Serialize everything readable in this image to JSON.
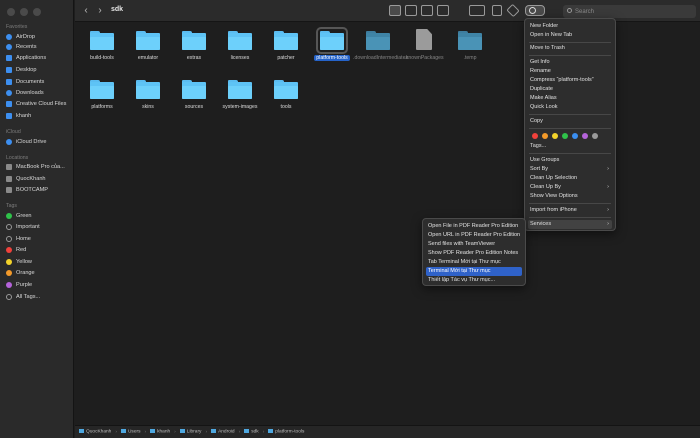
{
  "window": {
    "title": "sdk"
  },
  "search": {
    "placeholder": "Search"
  },
  "sidebar": {
    "favorites_header": "Favorites",
    "favorites": [
      "AirDrop",
      "Recents",
      "Applications",
      "Desktop",
      "Documents",
      "Downloads",
      "Creative Cloud Files",
      "khanh"
    ],
    "icloud_header": "iCloud",
    "icloud": [
      "iCloud Drive"
    ],
    "locations_header": "Locations",
    "locations": [
      "MacBook Pro của...",
      "QuocKhanh",
      "BOOTCAMP"
    ],
    "tags_header": "Tags",
    "tags": [
      {
        "label": "Green",
        "color": "#2fc24a"
      },
      {
        "label": "Important",
        "color": "#9a9a9a"
      },
      {
        "label": "Home",
        "color": "#9a9a9a"
      },
      {
        "label": "Red",
        "color": "#f0413b"
      },
      {
        "label": "Yellow",
        "color": "#f3d32b"
      },
      {
        "label": "Orange",
        "color": "#f39a2a"
      },
      {
        "label": "Purple",
        "color": "#b463d9"
      },
      {
        "label": "All Tags...",
        "color": "#9a9a9a"
      }
    ]
  },
  "files": [
    {
      "label": "build-tools",
      "kind": "folder"
    },
    {
      "label": "emulator",
      "kind": "folder"
    },
    {
      "label": "extras",
      "kind": "folder"
    },
    {
      "label": "licenses",
      "kind": "folder"
    },
    {
      "label": "patcher",
      "kind": "folder"
    },
    {
      "label": "platform-tools",
      "kind": "folder",
      "selected": true
    },
    {
      "label": ".downloadIntermediates",
      "kind": "hidden-folder"
    },
    {
      "label": ".knownPackages",
      "kind": "hidden-file"
    },
    {
      "label": ".temp",
      "kind": "hidden-folder"
    },
    {
      "label": "platforms",
      "kind": "folder"
    },
    {
      "label": "skins",
      "kind": "folder"
    },
    {
      "label": "sources",
      "kind": "folder"
    },
    {
      "label": "system-images",
      "kind": "folder"
    },
    {
      "label": "tools",
      "kind": "folder"
    }
  ],
  "pathbar": [
    "QuocKhanh",
    "Users",
    "khanh",
    "Library",
    "Android",
    "sdk",
    "platform-tools"
  ],
  "context_menu": {
    "new_folder": "New Folder",
    "open_new_tab": "Open in New Tab",
    "move_trash": "Move to Trash",
    "get_info": "Get Info",
    "rename": "Rename",
    "compress": "Compress “platform-tools”",
    "duplicate": "Duplicate",
    "make_alias": "Make Alias",
    "quick_look": "Quick Look",
    "copy": "Copy",
    "tags": "Tags...",
    "use_groups": "Use Groups",
    "sort_by": "Sort By",
    "clean_up_selection": "Clean Up Selection",
    "clean_up_by": "Clean Up By",
    "show_view_options": "Show View Options",
    "import_iphone": "Import from iPhone",
    "services": "Services",
    "tag_colors": [
      "#f0413b",
      "#f39a2a",
      "#f3d32b",
      "#2fc24a",
      "#3a8ef0",
      "#b463d9",
      "#9a9a9a"
    ]
  },
  "services_menu": {
    "items": [
      "Open File in PDF Reader Pro Edition",
      "Open URL in PDF Reader Pro Edition",
      "Send files with TeamViewer",
      "Show PDF Reader Pro Edition Notes",
      "Tab Terminal Mới tại Thư mục",
      "Terminal Mới tại Thư mục",
      "Thiết lập Tác vụ Thư mục..."
    ],
    "highlighted_index": 5
  }
}
